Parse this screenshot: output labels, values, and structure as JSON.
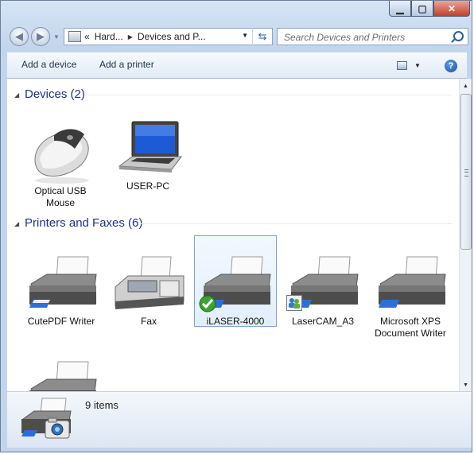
{
  "window": {
    "controls": {
      "minimize": "minimize",
      "maximize": "maximize",
      "close": "close"
    }
  },
  "address": {
    "crumbs": [
      "Hard...",
      "Devices and P..."
    ],
    "overflow_glyph": "«"
  },
  "search": {
    "placeholder": "Search Devices and Printers"
  },
  "toolbar": {
    "add_device": "Add a device",
    "add_printer": "Add a printer",
    "help": "?"
  },
  "groups": {
    "devices": {
      "title": "Devices (2)",
      "items": [
        {
          "line1": "Optical USB",
          "line2": "Mouse",
          "icon": "mouse-icon"
        },
        {
          "line1": "USER-PC",
          "line2": "",
          "icon": "laptop-icon"
        }
      ]
    },
    "printers": {
      "title": "Printers and Faxes (6)",
      "items": [
        {
          "line1": "CutePDF Writer",
          "line2": "",
          "icon": "printer-icon"
        },
        {
          "line1": "Fax",
          "line2": "",
          "icon": "fax-icon"
        },
        {
          "line1": "iLASER-4000",
          "line2": "",
          "icon": "printer-icon",
          "badge": "default-check-icon",
          "selected": true
        },
        {
          "line1": "LaserCAM_A3",
          "line2": "",
          "icon": "printer-icon",
          "badge": "shared-users-icon"
        },
        {
          "line1": "Microsoft XPS",
          "line2": "Document Writer",
          "icon": "printer-icon"
        }
      ]
    }
  },
  "details": {
    "count": "9 items",
    "icon": "printer-camera-icon"
  },
  "colors": {
    "group_title": "#1e3287",
    "accent": "#2a5fa5",
    "selection_border": "#7da2ce"
  }
}
